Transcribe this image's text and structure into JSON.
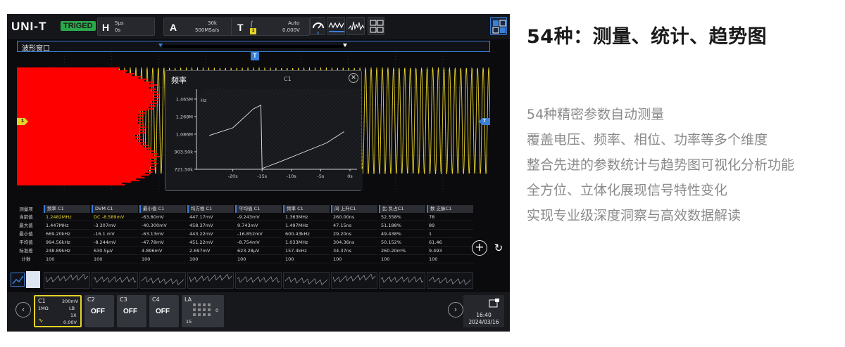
{
  "brand": {
    "logo": "UNI-T",
    "trigger_status": "TRIGED"
  },
  "topbar": {
    "h_label": "H",
    "h_timebase": "5μs",
    "h_delay": "0s",
    "a_label": "A",
    "a_points": "30k",
    "a_rate": "500MSa/s",
    "t_label": "T",
    "t_channel": "1",
    "t_mode": "Auto",
    "t_level": "0.000V"
  },
  "wave_window": {
    "title": "波形窗口",
    "ch_marker": "1",
    "trigger_marker": "T"
  },
  "trend_popup": {
    "title": "频率",
    "channel": "C1",
    "y_unit": "Hz",
    "y_ticks": [
      "1.465M",
      "1.268M",
      "1.086M",
      "903.50k",
      "721.50k"
    ],
    "x_ticks": [
      "-20s",
      "-15s",
      "-10s",
      "-5s",
      "0s"
    ]
  },
  "measurements": {
    "row_labels": [
      "测量项",
      "当前值",
      "最大值",
      "最小值",
      "平均值",
      "标准差",
      "计数"
    ],
    "columns": [
      {
        "head": "频率  C1",
        "values": [
          "1.2482MHz",
          "1.447MHz",
          "669.20kHz",
          "994.56kHz",
          "248.89kHz",
          "100"
        ],
        "current_hl": true
      },
      {
        "head": "DVM  C1",
        "values": [
          "DC -8.589mV",
          "-3.307mV",
          "-16.1 mV",
          "-8.244mV",
          "630.5μV",
          "100"
        ],
        "current_hl": true
      },
      {
        "head": "最小值  C1",
        "values": [
          "-63.80mV",
          "-40.300mV",
          "-63.13mV",
          "-47.78mV",
          "4.896mV",
          "100"
        ]
      },
      {
        "head": "均方根  C1",
        "values": [
          "447.17mV",
          "458.37mV",
          "443.22mV",
          "451.22mV",
          "2.697mV",
          "100"
        ]
      },
      {
        "head": "平均值  C1",
        "values": [
          "-9.243mV",
          "9.743mV",
          "-16.852mV",
          "-8.754mV",
          "623.28μV",
          "100"
        ]
      },
      {
        "head": "频率  C1",
        "values": [
          "1.363MHz",
          "1.497MHz",
          "600.43kHz",
          "1.033MHz",
          "157.4kHz",
          "100"
        ]
      },
      {
        "head": "间  上升C1",
        "values": [
          "260.00ns",
          "47.15ns",
          "29.20ns",
          "304.36ns",
          "34.37ns",
          "100"
        ]
      },
      {
        "head": "比  负占C1",
        "values": [
          "52.558%",
          "51.188%",
          "49.438%",
          "50.152%",
          "260.20m%",
          "100"
        ]
      },
      {
        "head": "数  正脉C1",
        "values": [
          "78",
          "89",
          "1",
          "61.46",
          "9.493",
          "100"
        ]
      }
    ]
  },
  "channels": [
    {
      "name": "C1",
      "scale": "200mV",
      "coupling": "1MΩ",
      "bw": "LB",
      "probe": "1X",
      "offset": "0.00V"
    },
    {
      "name": "C2",
      "state": "OFF"
    },
    {
      "name": "C3",
      "state": "OFF"
    },
    {
      "name": "C4",
      "state": "OFF"
    },
    {
      "name": "LA",
      "count_top": "0",
      "count_bottom": "15"
    }
  ],
  "clock": {
    "time": "16:40",
    "date": "2024/03/16"
  },
  "right_panel": {
    "heading": "54种：测量、统计、趋势图",
    "features": [
      "54种精密参数自动测量",
      "覆盖电压、频率、相位、功率等多个维度",
      "整合先进的参数统计与趋势图可视化分析功能",
      "全方位、立体化展现信号特性变化",
      "实现专业级深度洞察与高效数据解读"
    ]
  },
  "colors": {
    "ch1": "#e6d22a",
    "accent": "#3b7fd6",
    "histogram": "#ff0000"
  },
  "trend_series": {
    "x": [
      -24,
      -20,
      -16.5,
      -15.2,
      -15,
      -12,
      -8,
      -4,
      -1
    ],
    "y": [
      1.08,
      1.16,
      1.36,
      1.4,
      0.73,
      0.8,
      0.9,
      1.0,
      1.12
    ]
  }
}
